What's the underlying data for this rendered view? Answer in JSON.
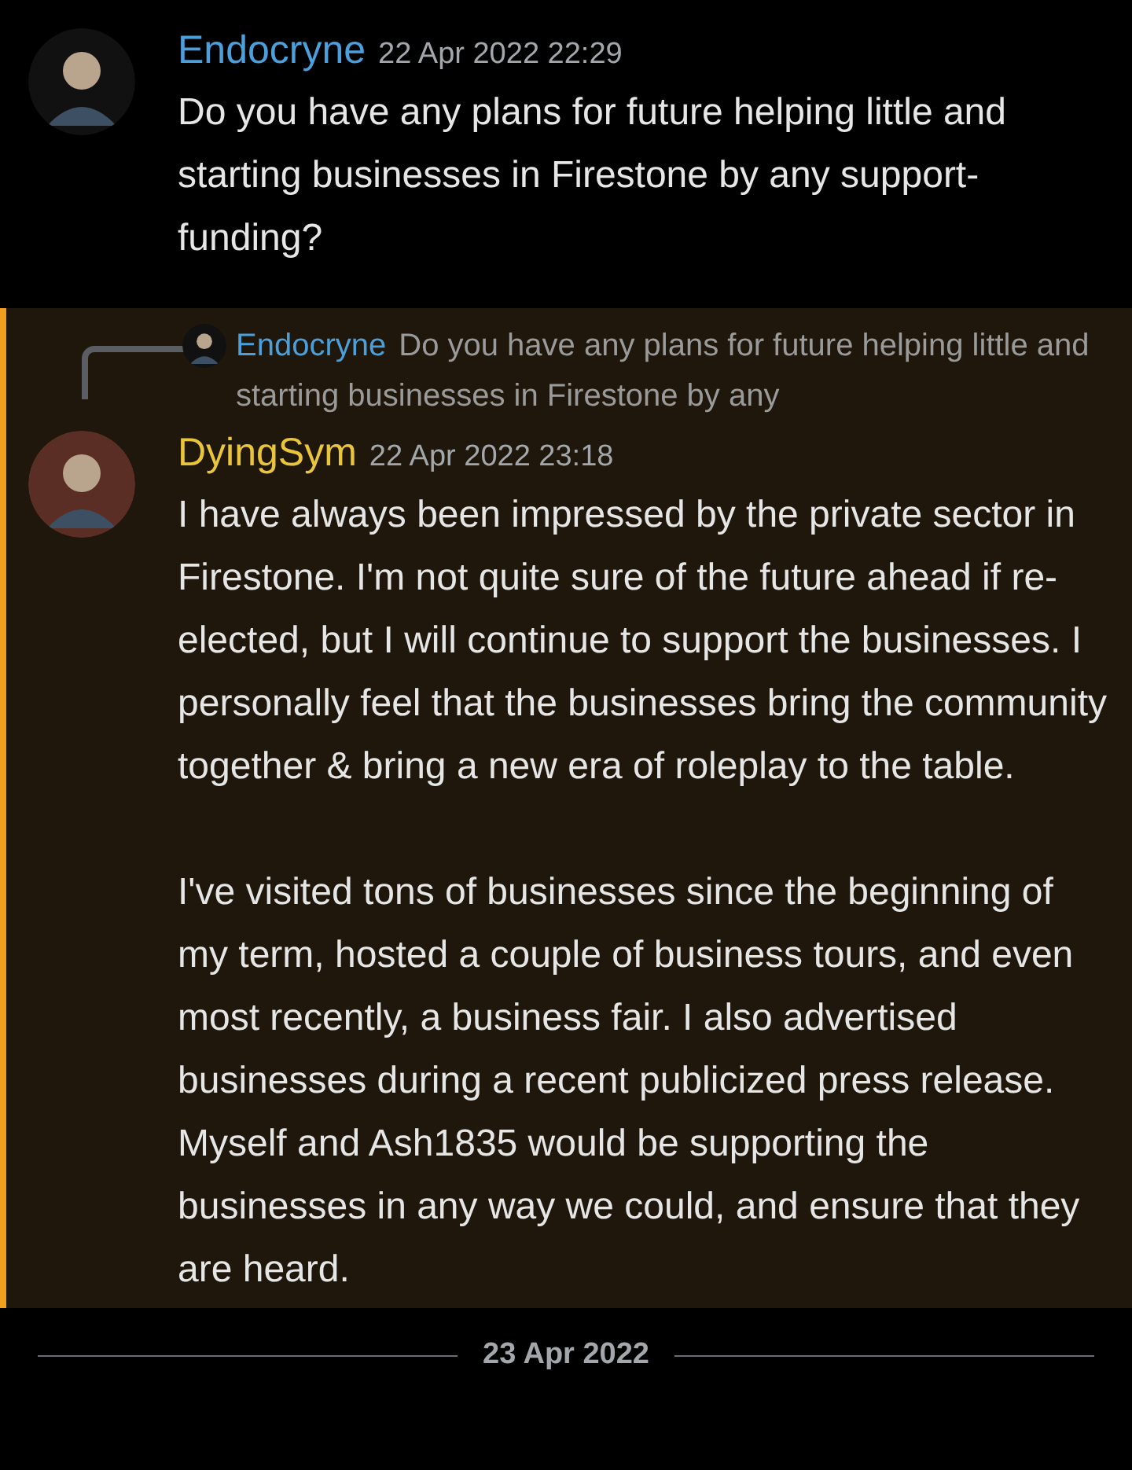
{
  "messages": [
    {
      "author": "Endocryne",
      "color": "#4b9fdb",
      "time": "22 Apr 2022 22:29",
      "highlighted": false,
      "paragraphs": [
        "Do you have any plans for future helping little and starting businesses in Firestone by any support-funding?"
      ]
    },
    {
      "author": "DyingSym",
      "color": "#e8c53a",
      "time": "22 Apr 2022 23:18",
      "highlighted": true,
      "reply": {
        "author": "Endocryne",
        "color": "#4b9fdb",
        "text": "Do you have any plans for future helping little and starting businesses in Firestone by any"
      },
      "paragraphs": [
        "I have always been impressed by the private sector in Firestone. I'm not quite sure of the future ahead if re-elected, but I will continue to support the businesses. I personally feel that the businesses bring the community together & bring a new era of roleplay to the table.",
        "I've visited tons of businesses since the beginning of my term, hosted a couple of business tours, and even most recently, a business fair. I also advertised businesses during a recent publicized press release. Myself and Ash1835 would be supporting the businesses in any way we could, and ensure that they are heard."
      ]
    }
  ],
  "date_divider": "23 Apr 2022"
}
